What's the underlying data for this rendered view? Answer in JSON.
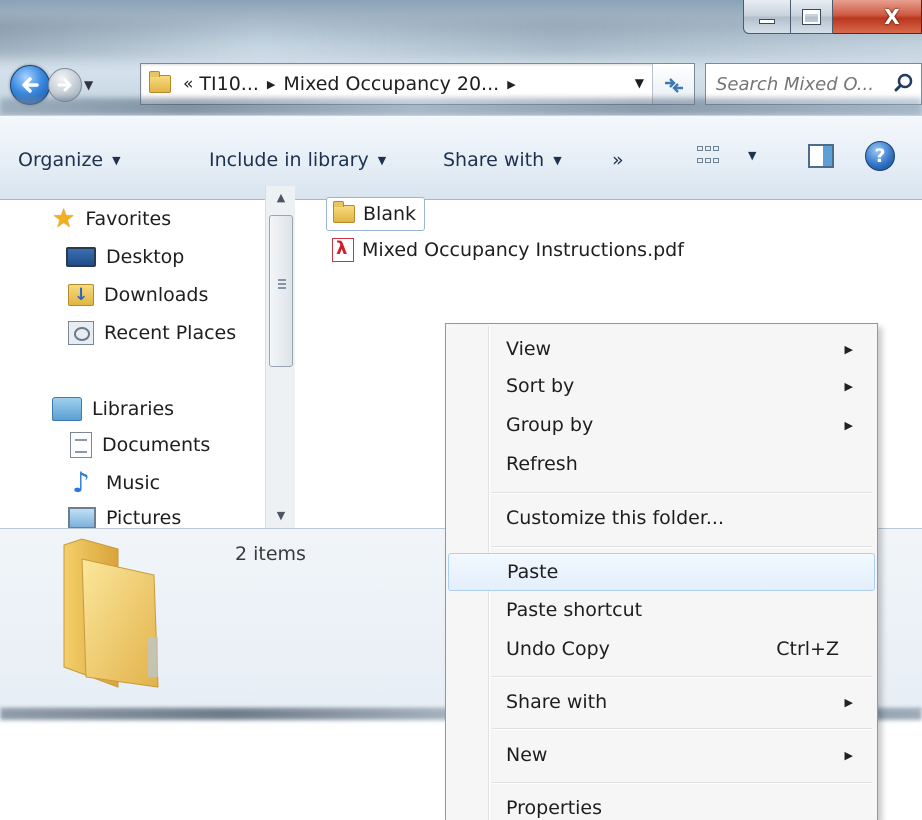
{
  "window": {
    "nav": {
      "back_icon": "back-arrow-icon",
      "forward_icon": "forward-arrow-icon"
    },
    "address": {
      "chevron": "«",
      "crumb_1": "TI10...",
      "crumb_2": "Mixed Occupancy 20...",
      "sep": "▶"
    },
    "search": {
      "placeholder": "Search Mixed O..."
    }
  },
  "toolbar": {
    "organize": "Organize",
    "include_in_library": "Include in library",
    "share_with": "Share with",
    "more": "»"
  },
  "nav_pane": {
    "favorites": "Favorites",
    "desktop": "Desktop",
    "downloads": "Downloads",
    "recent_places": "Recent Places",
    "libraries": "Libraries",
    "documents": "Documents",
    "music": "Music",
    "pictures": "Pictures"
  },
  "files": [
    {
      "name": "Blank",
      "type": "folder"
    },
    {
      "name": "Mixed Occupancy Instructions.pdf",
      "type": "pdf"
    }
  ],
  "details": {
    "items_count": "2 items"
  },
  "context_menu": {
    "view": "View",
    "sort_by": "Sort by",
    "group_by": "Group by",
    "refresh": "Refresh",
    "customize": "Customize this folder...",
    "paste": "Paste",
    "paste_shortcut": "Paste shortcut",
    "undo_copy": "Undo Copy",
    "undo_copy_shortcut": "Ctrl+Z",
    "share_with": "Share with",
    "new": "New",
    "properties": "Properties"
  },
  "colors": {
    "accent": "#1e3250",
    "highlight": "#e3effc",
    "close_button": "#c8472f"
  }
}
